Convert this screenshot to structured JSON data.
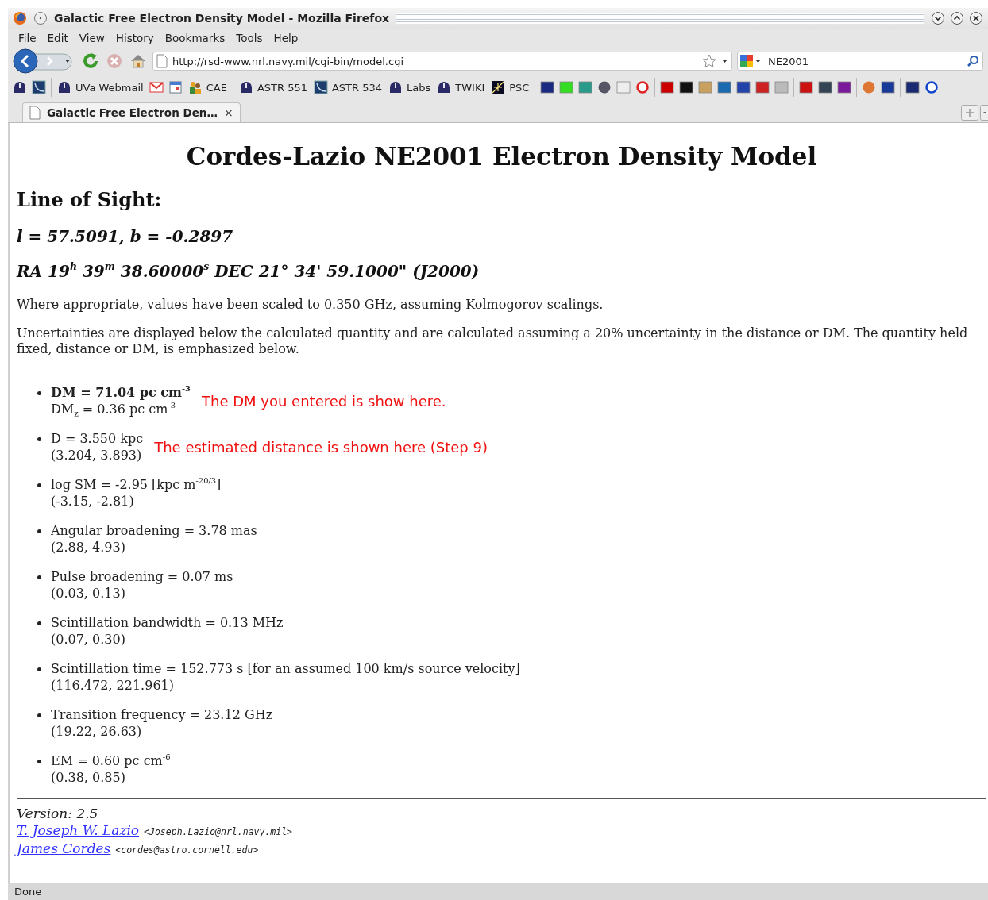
{
  "window": {
    "title": "Galactic Free Electron Density Model - Mozilla Firefox"
  },
  "menu": [
    "File",
    "Edit",
    "View",
    "History",
    "Bookmarks",
    "Tools",
    "Help"
  ],
  "navigation": {
    "url": "http://rsd-www.nrl.navy.mil/cgi-bin/model.cgi",
    "search": "NE2001"
  },
  "bookmarks": [
    {
      "kind": "dome"
    },
    {
      "kind": "dish"
    },
    {
      "kind": "separator"
    },
    {
      "kind": "dome",
      "label": "UVa Webmail"
    },
    {
      "kind": "mail"
    },
    {
      "kind": "calendar"
    },
    {
      "kind": "people",
      "label": "CAE"
    },
    {
      "kind": "separator"
    },
    {
      "kind": "dome",
      "label": "ASTR 551"
    },
    {
      "kind": "dish",
      "label": "ASTR 534"
    },
    {
      "kind": "dome",
      "label": "Labs"
    },
    {
      "kind": "dome",
      "label": "TWIKI"
    },
    {
      "kind": "starfield",
      "label": "PSC"
    },
    {
      "kind": "separator"
    },
    {
      "kind": "tile",
      "color": "#1a2a80"
    },
    {
      "kind": "tile",
      "color": "#33dd22"
    },
    {
      "kind": "tile",
      "color": "#2a9a8a"
    },
    {
      "kind": "disc",
      "color": "#555566"
    },
    {
      "kind": "tile",
      "color": "#eeeeee"
    },
    {
      "kind": "ring",
      "color": "#dd2222"
    },
    {
      "kind": "separator"
    },
    {
      "kind": "tile",
      "color": "#cc0000"
    },
    {
      "kind": "tile",
      "color": "#111111"
    },
    {
      "kind": "tile",
      "color": "#c8a060"
    },
    {
      "kind": "tile",
      "color": "#1a6ab0"
    },
    {
      "kind": "tile",
      "color": "#2244aa"
    },
    {
      "kind": "tile",
      "color": "#cc2222"
    },
    {
      "kind": "tile",
      "color": "#bbbbbb"
    },
    {
      "kind": "separator"
    },
    {
      "kind": "tile",
      "color": "#cc1111"
    },
    {
      "kind": "tile",
      "color": "#334455"
    },
    {
      "kind": "tile",
      "color": "#7a1a9a"
    },
    {
      "kind": "separator"
    },
    {
      "kind": "disc",
      "color": "#dd7733"
    },
    {
      "kind": "tile",
      "color": "#1a3a99"
    },
    {
      "kind": "separator"
    },
    {
      "kind": "tile",
      "color": "#1a2a70"
    },
    {
      "kind": "ring",
      "color": "#1144cc"
    }
  ],
  "tabs": [
    {
      "label": "Galactic Free Electron Den…",
      "close": "×",
      "selected": true
    }
  ],
  "page": {
    "title": "Cordes-Lazio NE2001 Electron Density Model",
    "section": "Line of Sight:",
    "coordinates": [
      "l = 57.5091, b = -0.2897",
      "RA 19$^{h}$ 39$^{m}$ 38.60000$^{s}$ DEC 21° 34' 59.1000\" (J2000)"
    ],
    "notes": [
      "Where appropriate, values have been scaled to 0.350 GHz, assuming Kolmogorov scalings.",
      "Uncertainties are displayed below the calculated quantity and are calculated assuming a 20% uncertainty in the distance or DM. The quantity held fixed, distance or DM, is emphasized below."
    ],
    "results": [
      {
        "value": "DM = 71.04 pc cm$^{-3}$",
        "range": "DM$_{z}$ = 0.36 pc cm$^{-3}$",
        "emphasized": true,
        "annotation": "The DM you entered is show here."
      },
      {
        "value": "D = 3.550 kpc",
        "range": "(3.204, 3.893)",
        "emphasized": false,
        "annotation": "The estimated distance is shown here (Step 9)"
      },
      {
        "value": "log SM = -2.95 [kpc m$^{-20/3}$]",
        "range": "(-3.15, -2.81)",
        "emphasized": false
      },
      {
        "value": "Angular broadening = 3.78 mas",
        "range": "(2.88, 4.93)",
        "emphasized": false
      },
      {
        "value": "Pulse broadening = 0.07 ms",
        "range": "(0.03, 0.13)",
        "emphasized": false
      },
      {
        "value": "Scintillation bandwidth = 0.13 MHz",
        "range": "(0.07, 0.30)",
        "emphasized": false
      },
      {
        "value": "Scintillation time = 152.773 s [for an assumed 100 km/s source velocity]",
        "range": "(116.472, 221.961)",
        "emphasized": false
      },
      {
        "value": "Transition frequency = 23.12 GHz",
        "range": "(19.22, 26.63)",
        "emphasized": false
      },
      {
        "value": "EM = 0.60 pc cm$^{-6}$",
        "range": "(0.38, 0.85)",
        "emphasized": false
      }
    ],
    "footer": {
      "version": "Version: 2.5",
      "authors": [
        {
          "name": "T. Joseph W. Lazio",
          "email": "<Joseph.Lazio@nrl.navy.mil>"
        },
        {
          "name": "James Cordes",
          "email": "<cordes@astro.cornell.edu>"
        }
      ]
    }
  },
  "status_bar": "Done"
}
